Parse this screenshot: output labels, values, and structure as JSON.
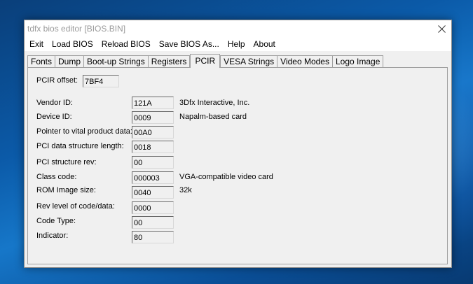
{
  "window": {
    "title": "tdfx bios editor [BIOS.BIN]"
  },
  "menu": [
    "Exit",
    "Load BIOS",
    "Reload BIOS",
    "Save BIOS As...",
    "Help",
    "About"
  ],
  "tabs": [
    "Fonts",
    "Dump",
    "Boot-up Strings",
    "Registers",
    "PCIR",
    "VESA Strings",
    "Video Modes",
    "Logo Image"
  ],
  "active_tab": "PCIR",
  "pcir": {
    "offset_label": "PCIR offset:",
    "offset_value": "7BF4",
    "fields": [
      {
        "label": "Vendor ID:",
        "value": "121A",
        "desc": "3Dfx Interactive, Inc."
      },
      {
        "label": "Device ID:",
        "value": "0009",
        "desc": "Napalm-based card"
      },
      {
        "label": "Pointer to vital product data:",
        "value": "00A0",
        "desc": ""
      },
      {
        "label": "PCI data structure length:",
        "value": "0018",
        "desc": ""
      },
      {
        "label": "PCI structure rev:",
        "value": "00",
        "desc": ""
      },
      {
        "label": "Class code:",
        "value": "000003",
        "desc": "VGA-compatible video card"
      },
      {
        "label": "ROM Image size:",
        "value": "0040",
        "desc": "32k"
      },
      {
        "label": "Rev level of code/data:",
        "value": "0000",
        "desc": ""
      },
      {
        "label": "Code Type:",
        "value": "00",
        "desc": ""
      },
      {
        "label": "Indicator:",
        "value": "80",
        "desc": ""
      }
    ]
  },
  "colors": {
    "desktop": "#0b5aa8",
    "window_bg": "#f0f0f0",
    "title_text": "#9a9a9a"
  }
}
